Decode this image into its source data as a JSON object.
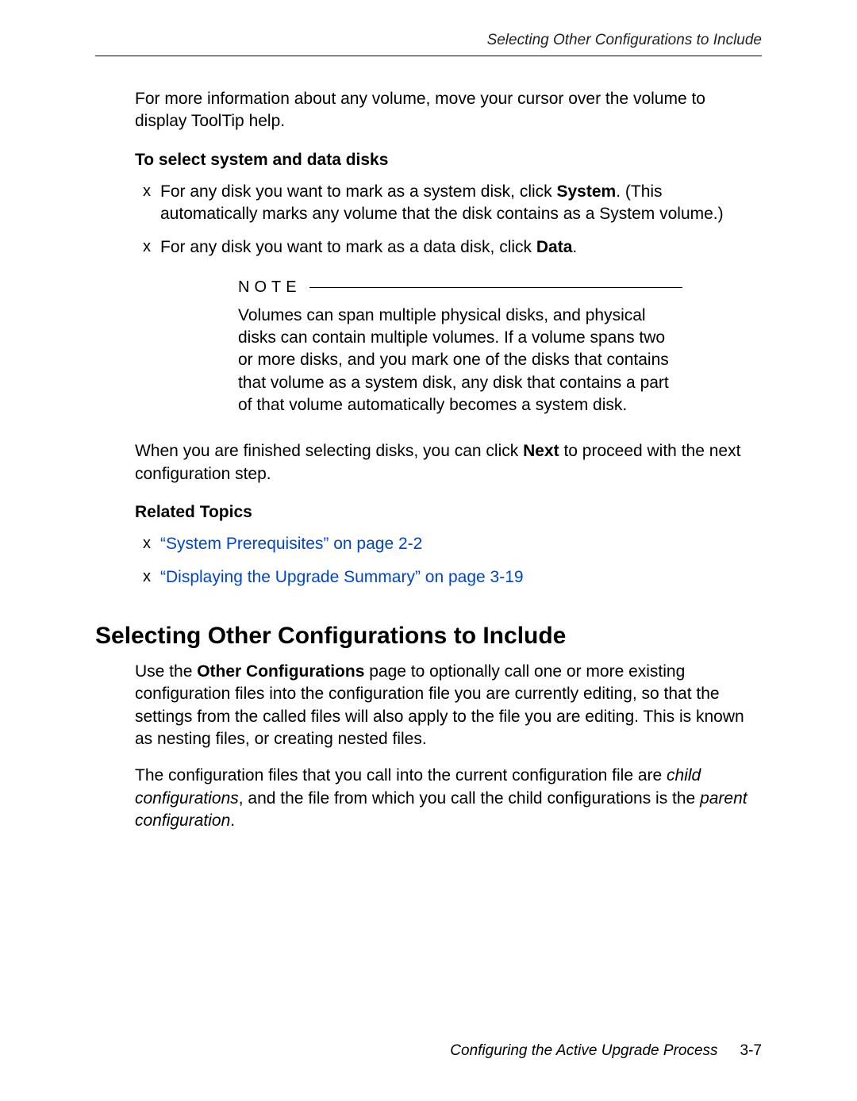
{
  "header": {
    "running_title": "Selecting Other Configurations to Include"
  },
  "body": {
    "intro_para": "For more information about any volume, move your cursor over the volume to display ToolTip help.",
    "procedure": {
      "heading": "To select system and data disks",
      "bullets": [
        {
          "pre": "For any disk you want to mark as a system disk, click ",
          "bold": "System",
          "post": ". (This automatically marks any volume that the disk contains as a System volume.)"
        },
        {
          "pre": "For any disk you want to mark as a data disk, click ",
          "bold": "Data",
          "post": "."
        }
      ]
    },
    "note": {
      "label": "NOTE",
      "text": "Volumes can span multiple physical disks, and physical disks can contain multiple volumes. If a volume spans two or more disks, and you mark one of the disks that contains that volume as a system disk, any disk that contains a part of that volume automatically becomes a system disk."
    },
    "after_note": {
      "pre": "When you are finished selecting disks, you can click ",
      "bold": "Next",
      "post": " to proceed with the next configuration step."
    },
    "related": {
      "heading": "Related Topics",
      "links": [
        "“System Prerequisites” on page 2-2",
        "“Displaying the Upgrade Summary” on page 3-19"
      ]
    },
    "section": {
      "title": "Selecting Other Configurations to Include",
      "para1_pre": "Use the ",
      "para1_bold": "Other Configurations",
      "para1_post": " page to optionally call one or more existing configuration files into the configuration file you are currently editing, so that the settings from the called files will also apply to the file you are editing. This is known as nesting files, or creating nested files.",
      "para2_pre": "The configuration files that you call into the current configuration file are ",
      "para2_it1": "child configurations",
      "para2_mid": ", and the file from which you call the child configurations is the ",
      "para2_it2": "parent configuration",
      "para2_end": "."
    }
  },
  "footer": {
    "chapter_title": "Configuring the Active Upgrade Process",
    "page_number": "3-7"
  }
}
